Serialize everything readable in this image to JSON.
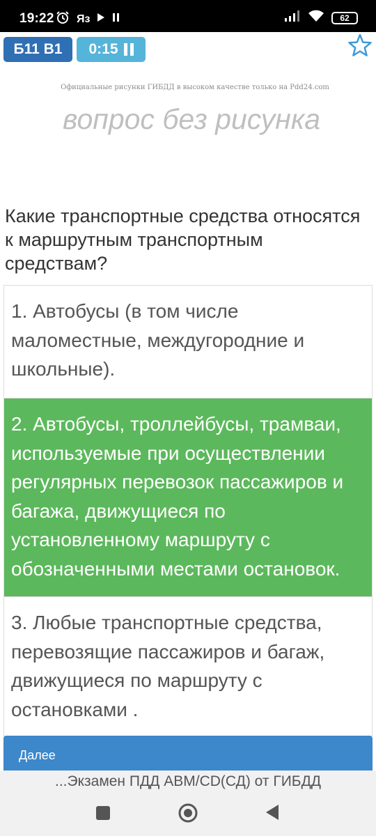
{
  "status_bar": {
    "time": "19:22",
    "battery": "62",
    "icons": [
      "alarm-icon",
      "media-icon",
      "play-icon",
      "pause-icon",
      "signal-icon",
      "wifi-icon",
      "battery-icon"
    ]
  },
  "toolbar": {
    "ticket_label": "Б11 В1",
    "timer_label": "0:15"
  },
  "image_area": {
    "watermark": "Официальные рисунки ГИБДД в высоком качестве только на Pdd24.com",
    "no_image_text": "вопрос без рисунка"
  },
  "question": {
    "text": "Какие транспортные средства относятся к маршрутным транспортным средствам?"
  },
  "answers": [
    {
      "text": "1. Автобусы (в том числе маломестные, междугородние и школьные)."
    },
    {
      "text": "2. Автобусы, троллейбусы, трамваи, используемые при осуществлении регулярных перевозок пассажиров и багажа, движущиеся по установленному маршруту с обозначенными местами остановок."
    },
    {
      "text": "3. Любые транспортные средства, перевозящие пассажиров и багаж, движущиеся по маршруту с остановками ."
    }
  ],
  "next_button": {
    "label": "Далее"
  },
  "bottom_banner": {
    "title": "...Экзамен ПДД ABM/CD(СД) от ГИБДД"
  },
  "colors": {
    "ticket_badge": "#2f6fb4",
    "timer_badge": "#55b4d9",
    "correct_answer": "#5cb85c",
    "next_button": "#3d87cb",
    "star": "#3d9ad6"
  }
}
